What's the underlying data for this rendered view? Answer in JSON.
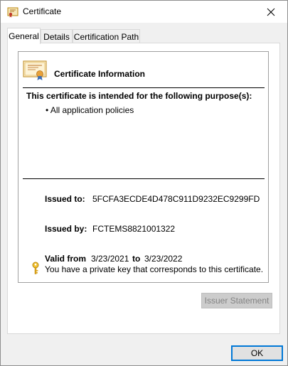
{
  "window": {
    "title": "Certificate",
    "icon": "certificate-icon",
    "close_icon": "close-icon"
  },
  "tabs": [
    {
      "label": "General",
      "active": true
    },
    {
      "label": "Details",
      "active": false
    },
    {
      "label": "Certification Path",
      "active": false
    }
  ],
  "general": {
    "info_title": "Certificate Information",
    "purpose_heading": "This certificate is intended for the following purpose(s):",
    "purposes": [
      "• All application policies"
    ],
    "issued_to_label": "Issued to:",
    "issued_to_value": "5FCFA3ECDE4D478C911D9232EC9299FD",
    "issued_by_label": "Issued by:",
    "issued_by_value": "FCTEMS8821001322",
    "valid_from_label": "Valid from",
    "valid_from_value": "3/23/2021",
    "valid_to_label": "to",
    "valid_to_value": "3/23/2022",
    "private_key_note": "You have a private key that corresponds to this certificate.",
    "issuer_statement_label": "Issuer Statement",
    "issuer_statement_enabled": false
  },
  "footer": {
    "ok_label": "OK"
  },
  "colors": {
    "accent": "#0078d7",
    "key_icon": "#d4a017",
    "disabled_button_bg": "#cccccc",
    "disabled_button_text": "#838383"
  }
}
